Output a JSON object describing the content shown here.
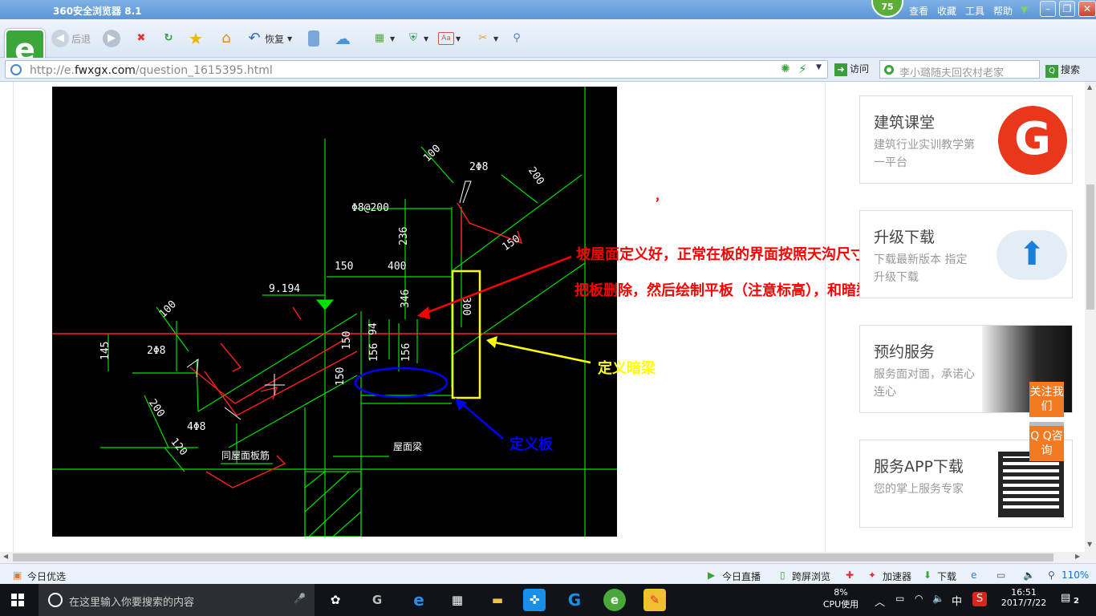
{
  "browser": {
    "title": "360安全浏览器 8.1",
    "score": "75",
    "menu": [
      "查看",
      "收藏",
      "工具",
      "帮助"
    ],
    "toolbar": {
      "back": "后退",
      "restore": "恢复"
    },
    "url_prefix": "http://e.",
    "url_domain": "fwxgx.com",
    "url_path": "/question_1615395.html",
    "visit_label": "访问",
    "search_placeholder": "李小璐随夫回农村老家",
    "search_label": "搜索"
  },
  "drawing": {
    "dims": [
      "100",
      "2Φ8",
      "200",
      "Φ8@200",
      "236",
      "150",
      "150",
      "400",
      "346",
      "300",
      "9.194",
      "100",
      "145",
      "2Φ8",
      "94",
      "156",
      "156",
      "150",
      "150",
      "200",
      "4Φ8",
      "120"
    ],
    "labels": {
      "roof_rebar": "同屋面板筋",
      "roof_beam": "屋面梁"
    }
  },
  "annotations": {
    "line1": "坡屋面定义好，正常在板的界面按照天沟尺寸分割板",
    "line2": "把板删除，然后绘制平板（注意标高），和暗梁。",
    "hidden_beam": "定义暗梁",
    "define_slab": "定义板",
    "mark": "，"
  },
  "sidebar": {
    "cards": [
      {
        "title": "建筑课堂",
        "desc": "建筑行业实训教学第一平台"
      },
      {
        "title": "升级下载",
        "desc": "下载最新版本  指定升级下载"
      },
      {
        "title": "预约服务",
        "desc": "服务面对面，承诺心连心"
      },
      {
        "title": "服务APP下载",
        "desc": "您的掌上服务专家"
      }
    ],
    "follow": "关注我们",
    "qq": "Q Q咨询"
  },
  "statusbar": {
    "left": "今日优选",
    "live": "今日直播",
    "cross": "跨屏浏览",
    "accel": "加速器",
    "download": "下载",
    "zoom": "110%"
  },
  "taskbar": {
    "search_placeholder": "在这里输入你要搜索的内容",
    "cpu": "8%",
    "cpu_label": "CPU使用",
    "ime": "中",
    "time": "16:51",
    "date": "2017/7/22",
    "notifications": "2"
  },
  "colors": {
    "accent": "#3da63a",
    "annotation_red": "#ff0000",
    "annotation_yellow": "#ffff00",
    "annotation_blue": "#0000ff"
  }
}
